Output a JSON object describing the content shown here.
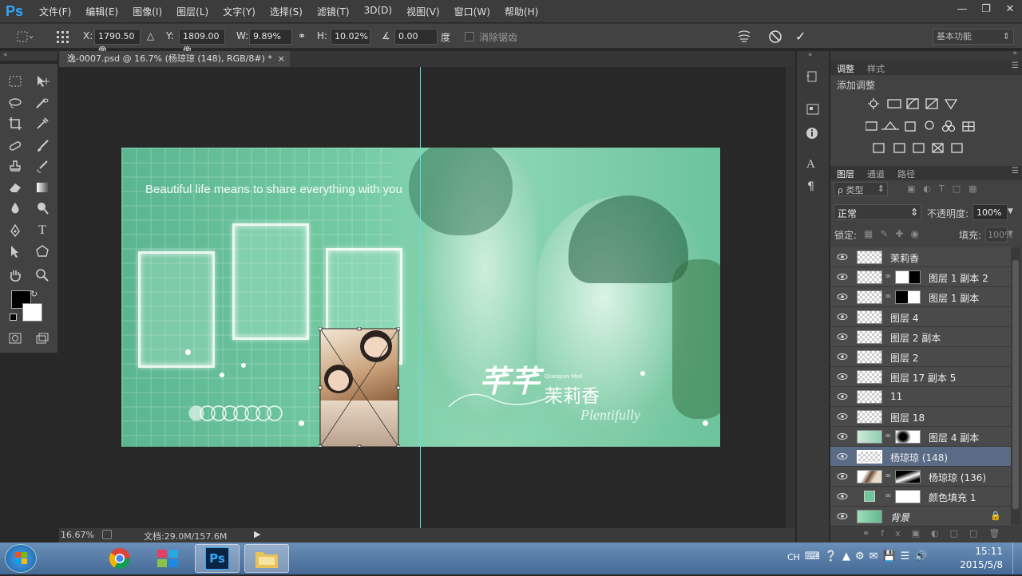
{
  "app": {
    "logo": "Ps"
  },
  "menu": [
    "文件(F)",
    "编辑(E)",
    "图像(I)",
    "图层(L)",
    "文字(Y)",
    "选择(S)",
    "滤镜(T)",
    "3D(D)",
    "视图(V)",
    "窗口(W)",
    "帮助(H)"
  ],
  "options": {
    "x_label": "X:",
    "x_value": "1790.50 像",
    "y_label": "Y:",
    "y_value": "1809.00 像",
    "w_label": "W:",
    "w_value": "9.89%",
    "h_label": "H:",
    "h_value": "10.02%",
    "angle_value": "0.00",
    "angle_unit": "度",
    "antialias_label": "消除锯齿",
    "workspace": "基本功能"
  },
  "document": {
    "tab_title": "逸-0007.psd @ 16.7% (杨琼琼 (148), RGB/8#) *",
    "zoom": "16.67%",
    "doc_size": "文档:29.0M/157.6M",
    "art_tagline": "Beautiful life means to share everything with you",
    "art_title": "芊芊",
    "art_name": "茉莉香",
    "art_small_en": "Qianqian Moli",
    "art_script": "Plentifully"
  },
  "adjust_panel": {
    "tabs": [
      "调整",
      "样式"
    ],
    "header": "添加调整"
  },
  "layers_panel": {
    "tabs": [
      "图层",
      "通道",
      "路径"
    ],
    "filter_label": "ρ 类型",
    "blend_mode": "正常",
    "opacity_label": "不透明度:",
    "opacity_value": "100%",
    "lock_label": "锁定:",
    "fill_label": "填充:",
    "fill_value": "100%",
    "layers": [
      {
        "name": "茉莉香"
      },
      {
        "name": "图层 1 副本 2"
      },
      {
        "name": "图层 1 副本"
      },
      {
        "name": "图层 4"
      },
      {
        "name": "图层 2 副本"
      },
      {
        "name": "图层 2"
      },
      {
        "name": "图层 17 副本 5"
      },
      {
        "name": "11"
      },
      {
        "name": "图层 18"
      },
      {
        "name": "图层 4 副本"
      },
      {
        "name": "杨琼琼 (148)"
      },
      {
        "name": "杨琼琼 (136)"
      },
      {
        "name": "颜色填充 1"
      },
      {
        "name": "背景"
      }
    ]
  },
  "taskbar": {
    "ime": "CH",
    "time": "15:11",
    "date": "2015/5/8"
  }
}
